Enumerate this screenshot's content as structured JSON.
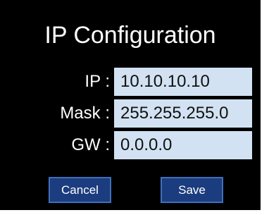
{
  "dialog": {
    "title": "IP Configuration",
    "fields": [
      {
        "label": "IP :",
        "value": "10.10.10.10"
      },
      {
        "label": "Mask :",
        "value": "255.255.255.0"
      },
      {
        "label": "GW :",
        "value": "0.0.0.0"
      }
    ],
    "buttons": {
      "cancel_label": "Cancel",
      "save_label": "Save"
    }
  },
  "colors": {
    "dialog_background": "#000000",
    "input_background": "#d2e2f2",
    "button_background": "#1b3c7e",
    "button_border": "#3f6fbd"
  }
}
